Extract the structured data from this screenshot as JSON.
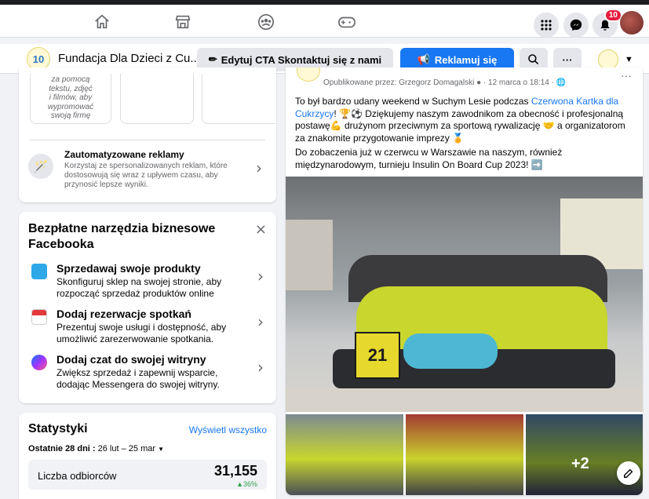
{
  "topnav": {
    "icons": [
      "home-icon",
      "marketplace-icon",
      "groups-icon",
      "gaming-icon"
    ],
    "notification_count": "10"
  },
  "pagebar": {
    "logo_text": "10",
    "page_name": "Fundacja Dla Dzieci z Cu...",
    "edit_cta_label": "Edytuj CTA Skontaktuj się z nami",
    "promote_label": "Reklamuj się",
    "more_label": "···"
  },
  "left": {
    "promo_card": {
      "desc_lines": [
        "za pomocą",
        "tekstu, zdjęć",
        "i filmów, aby",
        "wypromować",
        "swoją firmę"
      ]
    },
    "automated_ads": {
      "title": "Zautomatyzowane reklamy",
      "desc": "Korzystaj ze spersonalizowanych reklam, które dostosowują się wraz z upływem czasu, aby przynosić lepsze wyniki."
    },
    "tools": {
      "title": "Bezpłatne narzędzia biznesowe Facebooka",
      "items": [
        {
          "title": "Sprzedawaj swoje produkty",
          "desc": "Skonfiguruj sklep na swojej stronie, aby rozpocząć sprzedaż produktów online"
        },
        {
          "title": "Dodaj rezerwacje spotkań",
          "desc": "Prezentuj swoje usługi i dostępność, aby umożliwić zarezerwowanie spotkania."
        },
        {
          "title": "Dodaj czat do swojej witryny",
          "desc": "Zwiększ sprzedaż i zapewnij wsparcie, dodając Messengera do swojej witryny."
        }
      ]
    },
    "stats": {
      "title": "Statystyki",
      "view_all": "Wyświetl wszystko",
      "period_label": "Ostatnie 28 dni :",
      "period_range": "26 lut – 25 mar",
      "metric_label": "Liczba odbiorców",
      "metric_value": "31,155",
      "metric_change": "▲36%"
    }
  },
  "post": {
    "author_line": "Opublikowane przez: Grzegorz Domagalski",
    "date": "· 12 marca o 18:14 ·",
    "text_before_link": "To był bardzo udany weekend w Suchym Lesie podczas ",
    "link_text": "Czerwona Kartka dla Cukrzycy",
    "text_after_link": "! 🏆⚽ Dziękujemy naszym zawodnikom za obecność i profesjonalną postawę💪 drużynom przeciwnym za sportową rywalizację 🤝 a organizatorom za znakomite przygotowanie imprezy 🏅",
    "text2": "Do zobaczenia już w czerwcu w Warszawie na naszym, również międzynarodowym, turnieju Insulin On Board Cup 2023! ➡️",
    "jersey_number": "21",
    "more_photos": "+2"
  },
  "colors": {
    "accent": "#1877f2",
    "jersey": "#c8d62e",
    "badge": "#e41e3f"
  }
}
